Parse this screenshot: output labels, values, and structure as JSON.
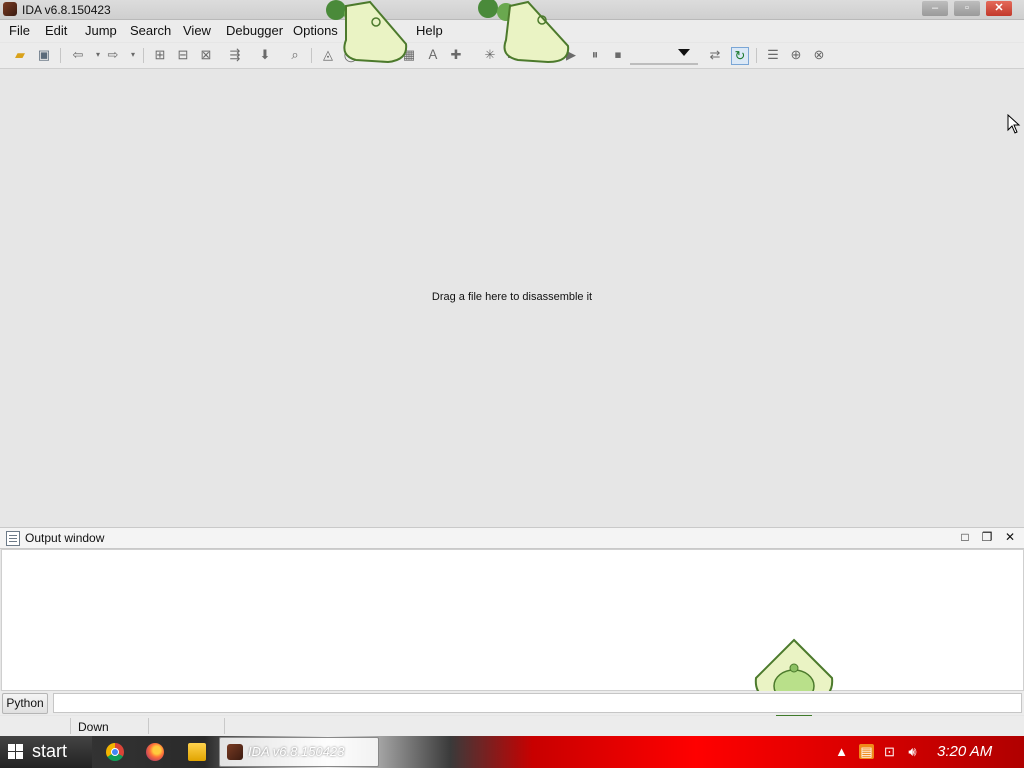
{
  "window": {
    "title": "IDA v6.8.150423",
    "minimize_glyph": "–",
    "maximize_glyph": "▫",
    "close_glyph": "✕"
  },
  "menu": {
    "items": [
      "File",
      "Edit",
      "Jump",
      "Search",
      "View",
      "Debugger",
      "Options",
      "Help"
    ]
  },
  "toolbar": {
    "icons": [
      "open-folder-icon",
      "save-icon",
      "back-arrow-icon",
      "forward-arrow-icon",
      "hex-view-icon",
      "text-view-icon",
      "number-view-icon",
      "navigate-icon",
      "down-arrow-icon",
      "search-icon",
      "graph-icon",
      "play-icon",
      "pause-icon",
      "stop-icon",
      "debugger-select",
      "source-icon",
      "refresh-icon",
      "list-icon",
      "add-icon",
      "remove-icon"
    ]
  },
  "main": {
    "hint": "Drag a file here to disassemble it"
  },
  "output_window": {
    "title": "Output window",
    "maximize_glyph": "□",
    "restore_glyph": "❐",
    "close_glyph": "✕"
  },
  "command_line": {
    "language_button": "Python"
  },
  "status_bar": {
    "text": "Down"
  },
  "taskbar": {
    "start_label": "start",
    "task_label": "IDA v6.8.150423",
    "clock": "3:20 AM"
  },
  "colors": {
    "background": "#e6e6e6",
    "close_button": "#c2392b",
    "taskbar_red": "#e00000"
  }
}
